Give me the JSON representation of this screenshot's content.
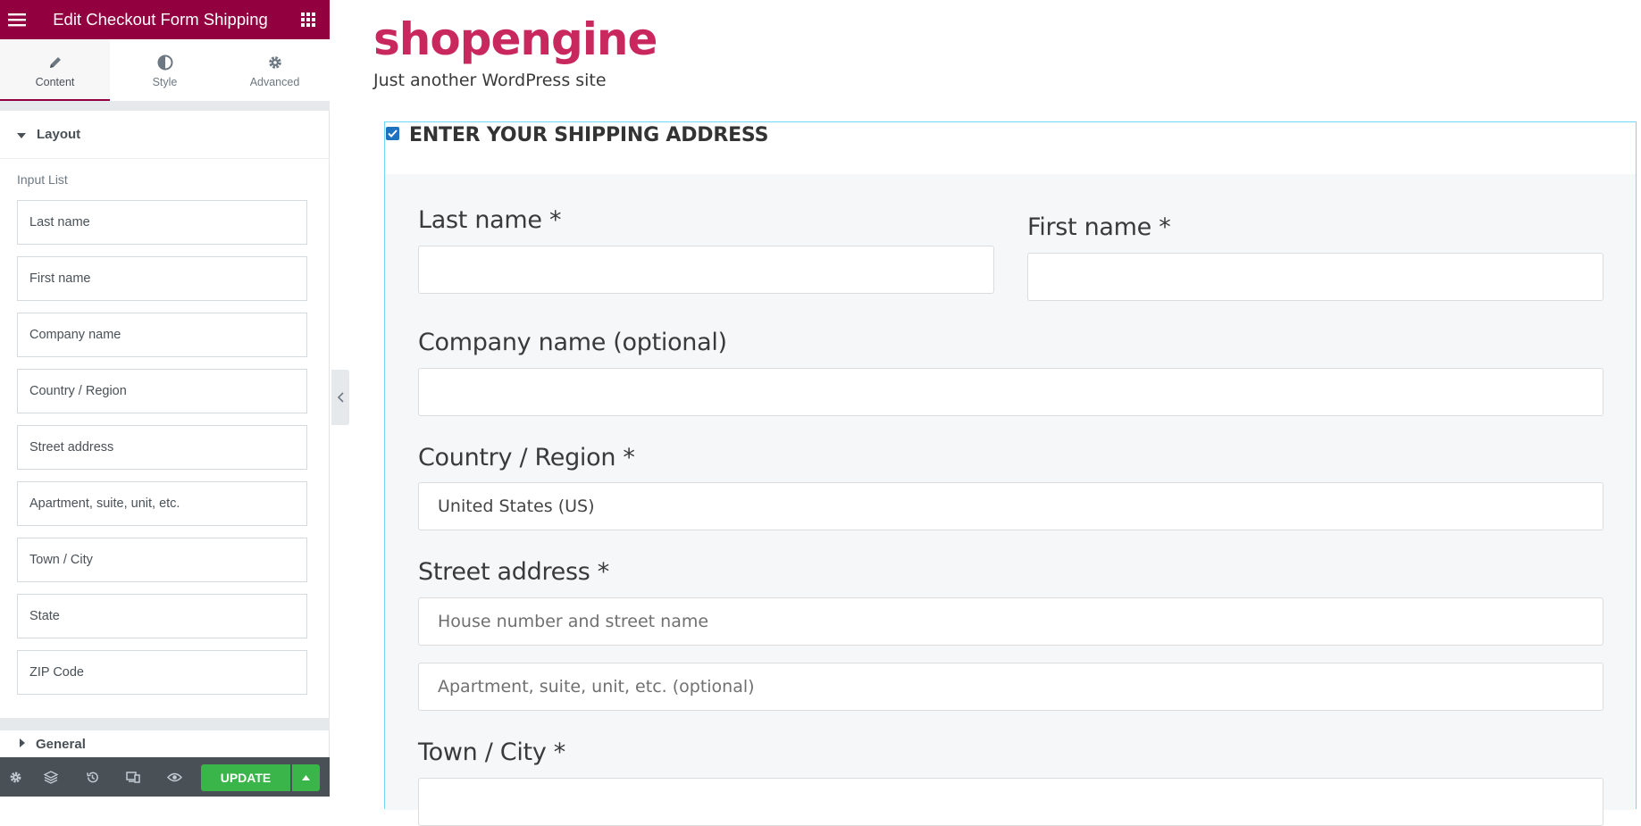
{
  "panel": {
    "header_title": "Edit Checkout Form Shipping",
    "tabs": [
      {
        "label": "Content",
        "icon": "pencil-icon",
        "active": true
      },
      {
        "label": "Style",
        "icon": "contrast-icon",
        "active": false
      },
      {
        "label": "Advanced",
        "icon": "gear-icon",
        "active": false
      }
    ],
    "section_layout": "Layout",
    "input_list_label": "Input List",
    "input_list": [
      "Last name",
      "First name",
      "Company name",
      "Country / Region",
      "Street address",
      "Apartment, suite, unit, etc.",
      "Town / City",
      "State",
      "ZIP Code"
    ],
    "section_general": "General",
    "footer": {
      "update_label": "UPDATE",
      "icons": [
        "settings-icon",
        "layers-icon",
        "history-icon",
        "responsive-icon",
        "preview-eye-icon"
      ]
    }
  },
  "preview": {
    "site_title": "shopengine",
    "site_tagline": "Just another WordPress site",
    "shipping_checkbox_checked": true,
    "shipping_heading": "ENTER YOUR SHIPPING ADDRESS",
    "fields": {
      "last_name_label": "Last name *",
      "first_name_label": "First name *",
      "company_label": "Company name (optional)",
      "country_label": "Country / Region *",
      "country_value": "United States (US)",
      "street_label": "Street address *",
      "street_placeholder": "House number and street name",
      "apartment_placeholder": "Apartment, suite, unit, etc. (optional)",
      "city_label": "Town / City *"
    }
  },
  "colors": {
    "panel_header": "#93003f",
    "update_button": "#39b54a",
    "site_title": "#c9285e",
    "widget_outline": "#71d7f7",
    "footer_bar": "#495157"
  }
}
